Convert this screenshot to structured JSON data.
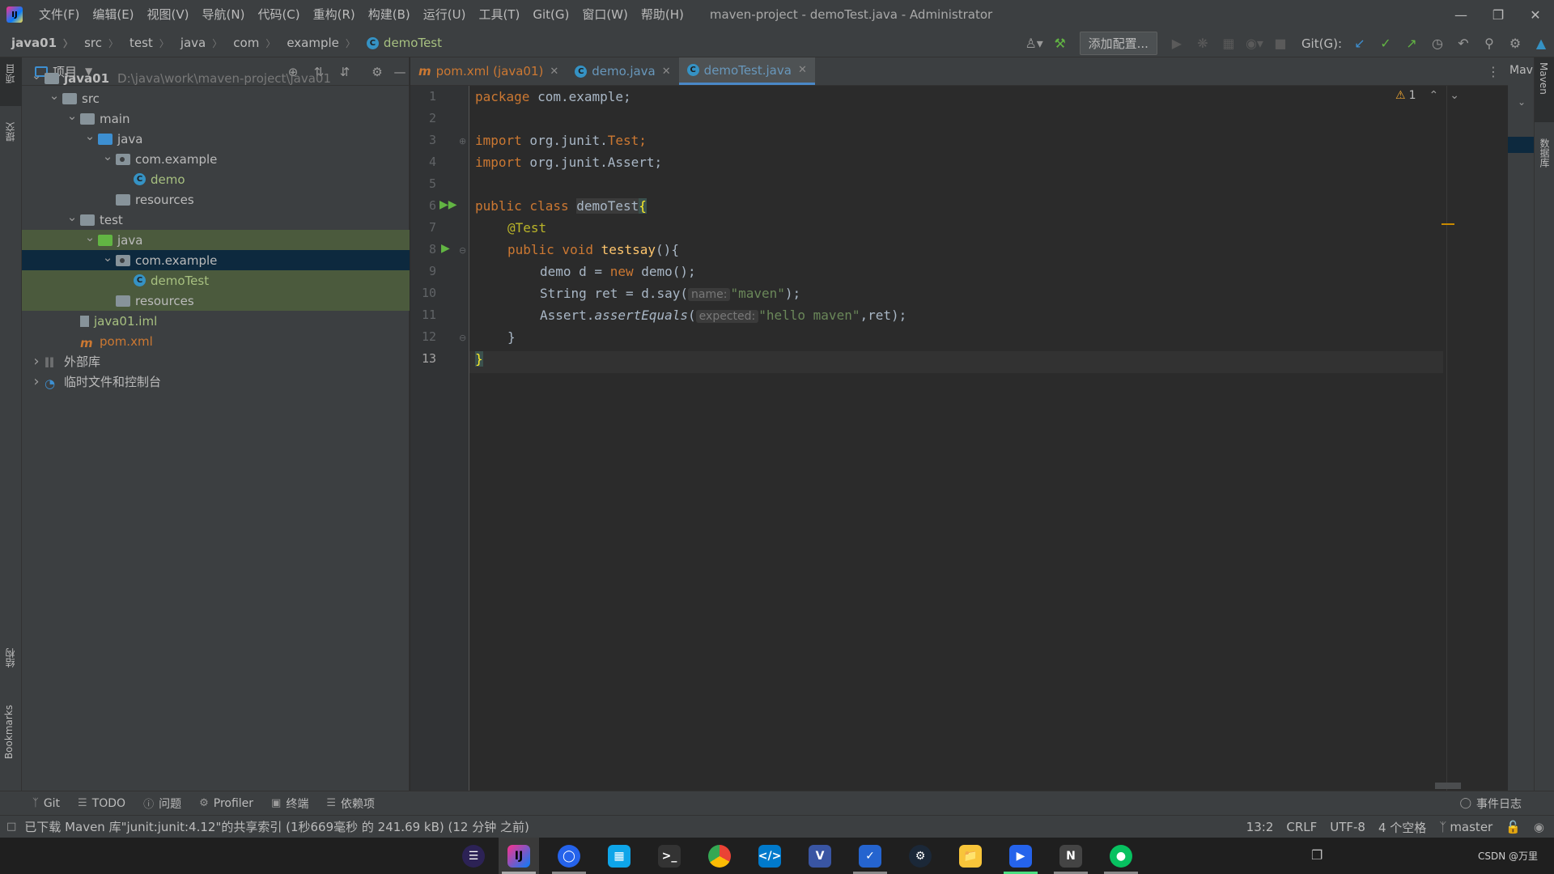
{
  "menu": {
    "items": [
      "文件(F)",
      "编辑(E)",
      "视图(V)",
      "导航(N)",
      "代码(C)",
      "重构(R)",
      "构建(B)",
      "运行(U)",
      "工具(T)",
      "Git(G)",
      "窗口(W)",
      "帮助(H)"
    ],
    "window_title": "maven-project - demoTest.java - Administrator"
  },
  "breadcrumb": [
    "java01",
    "src",
    "test",
    "java",
    "com",
    "example",
    "demoTest"
  ],
  "toolbar": {
    "add_config": "添加配置...",
    "git_label": "Git(G):"
  },
  "project_panel": {
    "title": "项目",
    "tree": [
      {
        "label": "java01",
        "path": "D:\\java\\work\\maven-project\\java01",
        "indent": 0,
        "arrow": "down",
        "icon": "module"
      },
      {
        "label": "src",
        "indent": 1,
        "arrow": "down",
        "icon": "folder"
      },
      {
        "label": "main",
        "indent": 2,
        "arrow": "down",
        "icon": "folder"
      },
      {
        "label": "java",
        "indent": 3,
        "arrow": "down",
        "icon": "folder-blue"
      },
      {
        "label": "com.example",
        "indent": 4,
        "arrow": "down",
        "icon": "package"
      },
      {
        "label": "demo",
        "indent": 5,
        "arrow": "",
        "icon": "class",
        "color": "green"
      },
      {
        "label": "resources",
        "indent": 4,
        "arrow": "",
        "icon": "folder-res"
      },
      {
        "label": "test",
        "indent": 2,
        "arrow": "down",
        "icon": "folder"
      },
      {
        "label": "java",
        "indent": 3,
        "arrow": "down",
        "icon": "folder-green",
        "sel": "light"
      },
      {
        "label": "com.example",
        "indent": 4,
        "arrow": "down",
        "icon": "package",
        "sel": "strong"
      },
      {
        "label": "demoTest",
        "indent": 5,
        "arrow": "",
        "icon": "class",
        "color": "green",
        "sel": "light"
      },
      {
        "label": "resources",
        "indent": 4,
        "arrow": "",
        "icon": "folder-res",
        "sel": "light"
      },
      {
        "label": "java01.iml",
        "indent": 2,
        "arrow": "",
        "icon": "iml",
        "color": "green"
      },
      {
        "label": "pom.xml",
        "indent": 2,
        "arrow": "",
        "icon": "maven",
        "color": "orange"
      },
      {
        "label": "外部库",
        "indent": 0,
        "arrow": "right",
        "icon": "lib"
      },
      {
        "label": "临时文件和控制台",
        "indent": 0,
        "arrow": "right",
        "icon": "scratch"
      }
    ]
  },
  "tabs": [
    {
      "label": "pom.xml (java01)",
      "icon": "m",
      "active": false
    },
    {
      "label": "demo.java",
      "icon": "c",
      "active": false
    },
    {
      "label": "demoTest.java",
      "icon": "c",
      "active": true
    }
  ],
  "editor": {
    "line_numbers": [
      "1",
      "2",
      "3",
      "4",
      "5",
      "6",
      "7",
      "8",
      "9",
      "10",
      "11",
      "12",
      "13"
    ],
    "current_line": "13",
    "code": {
      "l1_kw": "package",
      "l1_rest": " com.example;",
      "l3_kw": "import",
      "l3_rest": " org.junit.",
      "l3_cls": "Test",
      "l3_end": ";",
      "l4_kw": "import",
      "l4_rest": " org.junit.Assert;",
      "l6_kw": "public class",
      "l6_name": "demoTest",
      "l6_brace": "{",
      "l7_ann": "@Test",
      "l8_kw": "public void",
      "l8_fn": "testsay",
      "l8_rest": "(){",
      "l9_a": "demo d = ",
      "l9_kw": "new",
      "l9_b": " demo();",
      "l10_a": "String ret = d.say(",
      "l10_hint": "name:",
      "l10_str": "\"maven\"",
      "l10_b": ");",
      "l11_a": "Assert.",
      "l11_fn": "assertEquals",
      "l11_b": "(",
      "l11_hint": "expected:",
      "l11_str": "\"hello maven\"",
      "l11_c": ",ret);",
      "l12": "}",
      "l13": "}"
    },
    "warnings": "1"
  },
  "right_panels": {
    "maven": "Maven",
    "database": "数据库",
    "mav_short": "Mav"
  },
  "left_strip": {
    "project": "项目",
    "commit": "提交",
    "structure": "结构",
    "bookmarks": "Bookmarks"
  },
  "bottom_tools": [
    "Git",
    "TODO",
    "问题",
    "Profiler",
    "终端",
    "依赖项"
  ],
  "event_log": "事件日志",
  "status": {
    "message": "已下载 Maven 库\"junit:junit:4.12\"的共享索引 (1秒669毫秒 的 241.69 kB) (12 分钟 之前)",
    "position": "13:2",
    "line_sep": "CRLF",
    "encoding": "UTF-8",
    "indent": "4 个空格",
    "branch": "master"
  },
  "taskbar": {
    "apps": [
      "eclipse",
      "intellij",
      "edge-like",
      "app-blue",
      "terminal",
      "chrome",
      "vscode",
      "visio",
      "todo",
      "steam",
      "explorer",
      "player",
      "notepad",
      "wechat"
    ],
    "watermark": "CSDN @万里"
  },
  "colors": {
    "accent": "#4a88c7",
    "keyword": "#cc7832",
    "string": "#6a8759",
    "function": "#ffc66d"
  }
}
